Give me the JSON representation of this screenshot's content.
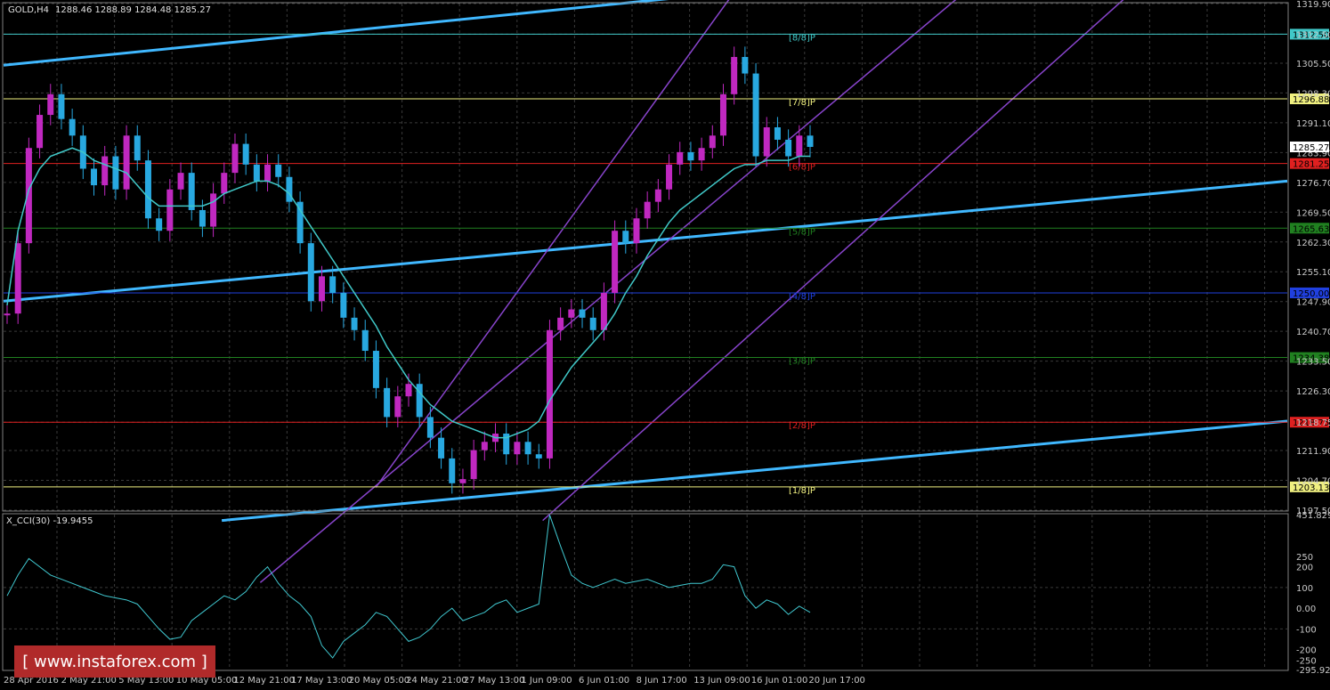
{
  "header": {
    "symbol": "GOLD,H4",
    "ohlc": "1288.46 1288.89 1284.48 1285.27"
  },
  "indicator": {
    "label": "X_CCI(30) -19.9455"
  },
  "watermark": "[ www.instaforex.com ]",
  "colors": {
    "bg": "#000000",
    "grid": "#3a3a3a",
    "bull": "#c028c0",
    "bear": "#28a8e0",
    "ma": "#40c8c8",
    "channel": "#8844cc",
    "trend": "#40b8ff",
    "cci": "#40c8d0",
    "axis_text": "#c8c8c8"
  },
  "chart_data": [
    {
      "type": "candlestick",
      "title": "GOLD,H4",
      "ylim": [
        1197.5,
        1319.9
      ],
      "y_ticks": [
        "1319.90",
        "1312.50",
        "1305.50",
        "1298.30",
        "1291.10",
        "1283.90",
        "1276.70",
        "1269.50",
        "1262.30",
        "1255.10",
        "1247.90",
        "1240.70",
        "1233.50",
        "1226.30",
        "1218.75",
        "1211.90",
        "1204.70",
        "1197.50"
      ],
      "x_ticks": [
        "28 Apr 2016",
        "2 May 21:00",
        "5 May 13:00",
        "10 May 05:00",
        "12 May 21:00",
        "17 May 13:00",
        "20 May 05:00",
        "24 May 21:00",
        "27 May 13:00",
        "1 Jun 09:00",
        "6 Jun 01:00",
        "8 Jun 17:00",
        "13 Jun 09:00",
        "16 Jun 01:00",
        "20 Jun 17:00"
      ],
      "close_path": [
        1245,
        1262,
        1285,
        1293,
        1298,
        1292,
        1288,
        1280,
        1276,
        1283,
        1275,
        1288,
        1282,
        1268,
        1265,
        1275,
        1279,
        1270,
        1266,
        1274,
        1279,
        1286,
        1281,
        1277,
        1281,
        1278,
        1272,
        1262,
        1248,
        1254,
        1250,
        1244,
        1241,
        1236,
        1227,
        1220,
        1225,
        1228,
        1220,
        1215,
        1210,
        1204,
        1205,
        1212,
        1214,
        1216,
        1211,
        1214,
        1211,
        1210,
        1241,
        1244,
        1246,
        1244,
        1241,
        1250,
        1265,
        1262,
        1268,
        1272,
        1275,
        1281,
        1284,
        1282,
        1285,
        1288,
        1298,
        1307,
        1303,
        1283,
        1290,
        1287,
        1283,
        1288,
        1285.27
      ],
      "moving_average": [
        1247,
        1265,
        1275,
        1280,
        1283,
        1284,
        1285,
        1284,
        1282,
        1281,
        1280,
        1279,
        1276,
        1273,
        1271,
        1271,
        1271,
        1271,
        1271,
        1272,
        1274,
        1275,
        1276,
        1277,
        1277,
        1276,
        1274,
        1270,
        1266,
        1262,
        1258,
        1254,
        1250,
        1246,
        1242,
        1237,
        1233,
        1229,
        1226,
        1223,
        1221,
        1219,
        1218,
        1217,
        1216,
        1215,
        1215,
        1216,
        1217,
        1219,
        1224,
        1228,
        1232,
        1235,
        1238,
        1241,
        1245,
        1250,
        1254,
        1259,
        1263,
        1267,
        1270,
        1272,
        1274,
        1276,
        1278,
        1280,
        1281,
        1281,
        1282,
        1282,
        1282,
        1283,
        1283
      ],
      "murrey_levels": [
        {
          "label": "[8/8]P",
          "value": "1312.50",
          "color": "#40c8c8"
        },
        {
          "label": "[7/8]P",
          "value": "1296.88",
          "color": "#f0f080"
        },
        {
          "label": "[6/8]P",
          "value": "1281.25",
          "color": "#e02020"
        },
        {
          "label": "[5/8]P",
          "value": "1265.63",
          "color": "#208020"
        },
        {
          "label": "[4/8]P",
          "value": "1250.00",
          "color": "#2040e0"
        },
        {
          "label": "[3/8]P",
          "value": "1234.38",
          "color": "#208020"
        },
        {
          "label": "[2/8]P",
          "value": "1218.75",
          "color": "#e02020"
        },
        {
          "label": "[1/8]P",
          "value": "1203.13",
          "color": "#f0f080"
        }
      ],
      "current_price": "1285.27"
    },
    {
      "type": "line",
      "title": "X_CCI(30) -19.9455",
      "ylim": [
        -295.9265,
        451.8296
      ],
      "y_ticks": [
        "451.8296",
        "250",
        "200",
        "100",
        "0.00",
        "-100",
        "-200",
        "-250",
        "-295.9265"
      ],
      "values": [
        60,
        160,
        240,
        200,
        160,
        140,
        120,
        100,
        80,
        60,
        50,
        40,
        20,
        -40,
        -100,
        -150,
        -140,
        -60,
        -20,
        20,
        60,
        40,
        80,
        150,
        200,
        120,
        60,
        20,
        -40,
        -180,
        -240,
        -160,
        -120,
        -80,
        -20,
        -40,
        -100,
        -160,
        -140,
        -100,
        -40,
        0,
        -60,
        -40,
        -20,
        20,
        40,
        -20,
        0,
        20,
        450,
        300,
        160,
        120,
        100,
        120,
        140,
        120,
        130,
        140,
        120,
        100,
        110,
        120,
        120,
        140,
        210,
        200,
        60,
        0,
        40,
        20,
        -30,
        10,
        -20
      ]
    }
  ]
}
